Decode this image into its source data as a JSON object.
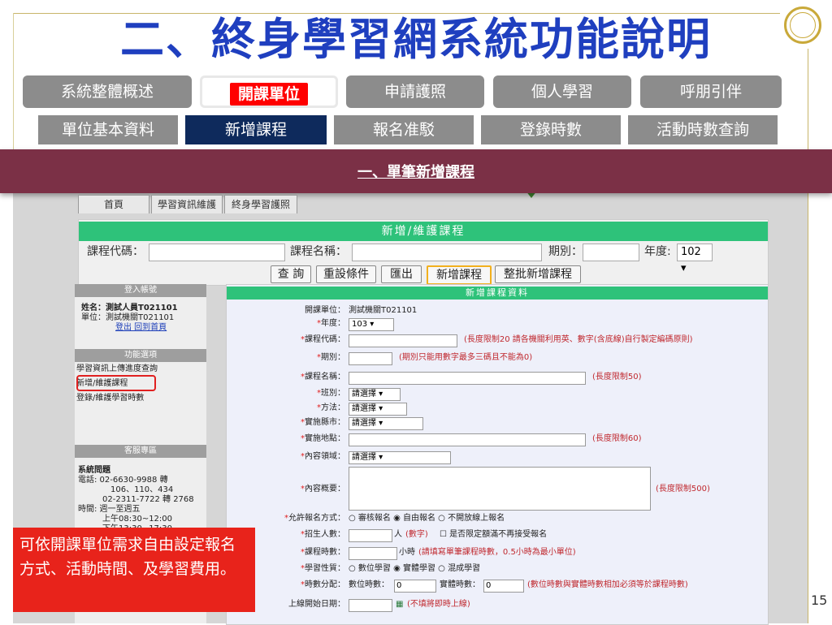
{
  "slide": {
    "title": "二、終身學習網系統功能說明",
    "page_number": "15",
    "callout": "可依開課單位需求自由設定報名方式、活動時間、及學習費用。"
  },
  "main_tabs": [
    {
      "label": "系統整體概述"
    },
    {
      "label": "開課單位"
    },
    {
      "label": "申請護照"
    },
    {
      "label": "個人學習"
    },
    {
      "label": "呼朋引伴"
    }
  ],
  "sub_tabs": [
    {
      "label": "單位基本資料"
    },
    {
      "label": "新增課程"
    },
    {
      "label": "報名准駁"
    },
    {
      "label": "登錄時數"
    },
    {
      "label": "活動時數查詢"
    }
  ],
  "banner": {
    "text": "一、單筆新增課程"
  },
  "screenshot": {
    "nav_tabs": [
      "首頁",
      "學習資訊維護",
      "終身學習護照"
    ],
    "search": {
      "title": "新增/維護課程",
      "course_code_label": "課程代碼：",
      "course_name_label": "課程名稱：",
      "period_label": "期別：",
      "year_label": "年度:",
      "year_value": "102",
      "buttons": [
        "查 詢",
        "重設條件",
        "匯出",
        "新增課程",
        "整批新增課程"
      ]
    },
    "login_box": {
      "title": "登入帳號",
      "name": "姓名：測試人員T021101",
      "unit": "單位：測試機關T021101",
      "links": "登出 回到首頁"
    },
    "function_box": {
      "title": "功能選項",
      "items": [
        "學習資訊上傳進度查詢",
        "新增/維護課程",
        "登錄/維護學習時數"
      ]
    },
    "service_box": {
      "title": "客服專區",
      "lines": [
        "系統問題",
        "電話: 02-6630-9988 轉",
        "106、110、434",
        "02-2311-7722 轉 2768",
        "時間: 週一至週五",
        "上午08:30~12:00",
        "下午13:30~17:30"
      ]
    },
    "form": {
      "title": "新增課程資料",
      "unit_label": "開課單位：",
      "unit_value": "測試機關T021101",
      "year_label": "年度：",
      "year_value": "103",
      "code_label": "課程代碼：",
      "code_note": "(長度限制20 請各機關利用英、數字(含底線)自行製定編碼原則)",
      "period_label": "期別：",
      "period_note": "(期別只能用數字最多三碼且不能為0)",
      "name_label": "課程名稱：",
      "name_note": "(長度限制50)",
      "class_label": "班別：",
      "method_label": "方法：",
      "city_label": "實施縣市：",
      "place_label": "實施地點：",
      "place_note": "(長度限制60)",
      "domain_label": "內容領域：",
      "summary_label": "內容概要：",
      "summary_note": "(長度限制500)",
      "select_placeholder": "請選擇",
      "signup_label": "允許報名方式：",
      "signup_options": "審核報名 ◉ 自由報名 ○ 不開放線上報名",
      "quota_label": "招生人數：",
      "quota_unit": "人",
      "quota_note": "(數字)",
      "quota_check": "是否限定額滿不再接受報名",
      "hours_label": "課程時數：",
      "hours_unit": "小時",
      "hours_note": "(請填寫單筆課程時數，0.5小時為最小單位)",
      "nature_label": "學習性質：",
      "nature_options": "○ 數位學習 ◉ 實體學習 ○ 混成學習",
      "alloc_label": "時數分配：",
      "alloc_digital": "數位時數：",
      "alloc_physical": "實體時數：",
      "alloc_value": "0",
      "alloc_note": "(數位時數與實體時數相加必須等於課程時數)",
      "start_label": "上線開始日期：",
      "start_note": "(不填將即時上線)"
    }
  },
  "colors": {
    "title_blue": "#1f3fbf",
    "active_tab_red": "#ff0000",
    "banner_maroon": "#7b3046",
    "callout_red": "#e8231b",
    "form_header_green": "#2ec27a"
  }
}
